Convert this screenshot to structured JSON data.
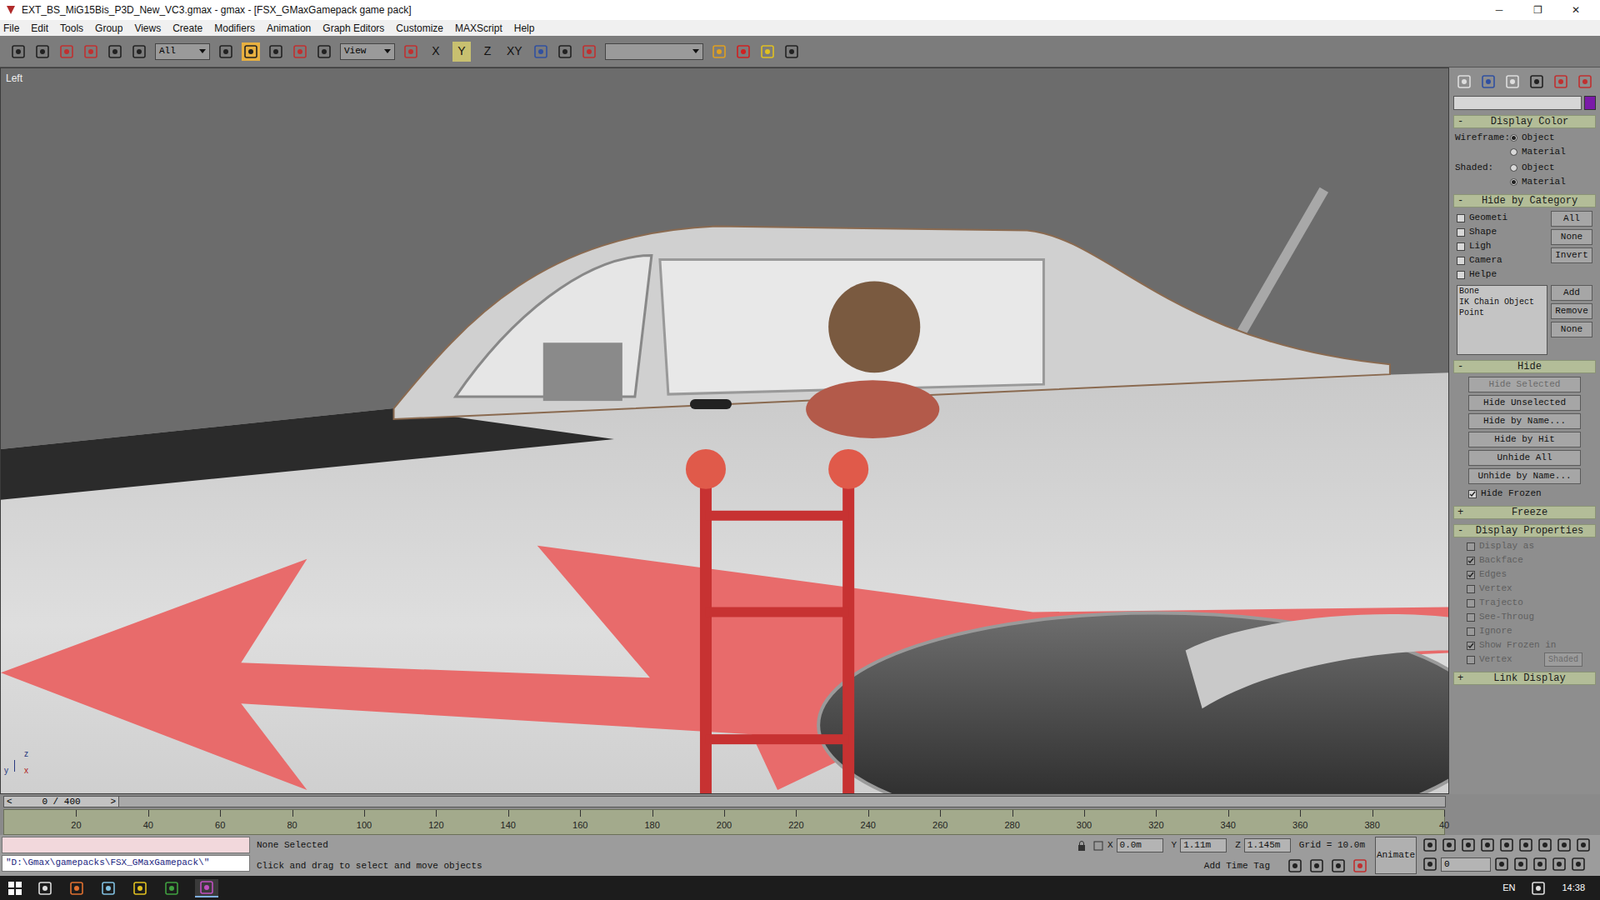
{
  "window": {
    "title": "EXT_BS_MiG15Bis_P3D_New_VC3.gmax - gmax - [FSX_GMaxGamepack game pack]",
    "controls": [
      "─",
      "❐",
      "✕"
    ]
  },
  "menu": [
    "File",
    "Edit",
    "Tools",
    "Group",
    "Views",
    "Create",
    "Modifiers",
    "Animation",
    "Graph Editors",
    "Customize",
    "MAXScript",
    "Help"
  ],
  "toolbar": {
    "selection_filter": "All",
    "reference_coord": "View",
    "named_selection": "",
    "axes": [
      {
        "label": "X",
        "selected": false
      },
      {
        "label": "Y",
        "selected": true
      },
      {
        "label": "Z",
        "selected": false
      },
      {
        "label": "XY",
        "selected": false
      }
    ]
  },
  "viewport": {
    "label": "Left",
    "axis_labels": [
      "z",
      "y",
      "x"
    ]
  },
  "command_panel": {
    "name_field": "",
    "display_color": {
      "title": "Display Color",
      "sign": "-",
      "expanded": true,
      "wireframe_label": "Wireframe:",
      "shaded_label": "Shaded:",
      "wireframe": [
        {
          "label": "Object",
          "selected": true
        },
        {
          "label": "Material",
          "selected": false
        }
      ],
      "shaded": [
        {
          "label": "Object",
          "selected": false
        },
        {
          "label": "Material",
          "selected": true
        }
      ]
    },
    "hide_by_category": {
      "title": "Hide by Category",
      "sign": "-",
      "expanded": true,
      "categories": [
        {
          "label": "Geometi",
          "checked": false
        },
        {
          "label": "Shape",
          "checked": false
        },
        {
          "label": "Ligh",
          "checked": false
        },
        {
          "label": "Camera",
          "checked": false
        },
        {
          "label": "Helpe",
          "checked": false
        }
      ],
      "buttons": [
        "All",
        "None",
        "Invert"
      ],
      "list": [
        "Bone",
        "IK Chain Object",
        "Point"
      ],
      "list_buttons": [
        "Add",
        "Remove",
        "None"
      ]
    },
    "hide": {
      "title": "Hide",
      "sign": "-",
      "expanded": true,
      "buttons": [
        {
          "label": "Hide Selected",
          "disabled": true
        },
        {
          "label": "Hide Unselected",
          "disabled": false
        },
        {
          "label": "Hide by Name...",
          "disabled": false
        },
        {
          "label": "Hide by Hit",
          "disabled": false
        },
        {
          "label": "Unhide All",
          "disabled": false
        },
        {
          "label": "Unhide by Name...",
          "disabled": false
        }
      ],
      "hide_frozen": {
        "label": "Hide Frozen",
        "checked": true
      }
    },
    "freeze": {
      "title": "Freeze",
      "sign": "+",
      "expanded": false
    },
    "display_properties": {
      "title": "Display Properties",
      "sign": "-",
      "expanded": true,
      "options": [
        {
          "label": "Display as",
          "checked": false
        },
        {
          "label": "Backface",
          "checked": true
        },
        {
          "label": "Edges",
          "checked": true
        },
        {
          "label": "Vertex",
          "checked": false
        },
        {
          "label": "Trajecto",
          "checked": false
        },
        {
          "label": "See-Throug",
          "checked": false
        },
        {
          "label": "Ignore",
          "checked": false
        },
        {
          "label": "Show Frozen in",
          "checked": true
        },
        {
          "label": "Vertex",
          "checked": false
        }
      ],
      "disabled": true,
      "shaded_button": "Shaded"
    },
    "link_display": {
      "title": "Link Display",
      "sign": "+",
      "expanded": false
    }
  },
  "time_slider": {
    "label": "0 / 400",
    "prev": "<",
    "next": ">",
    "level": 0
  },
  "track_bar": {
    "ticks": [
      "20",
      "40",
      "60",
      "80",
      "100",
      "120",
      "140",
      "160",
      "180",
      "200",
      "220",
      "240",
      "260",
      "280",
      "300",
      "320",
      "340",
      "360",
      "380",
      "40"
    ]
  },
  "status": {
    "listener": "",
    "path": "\"D:\\Gmax\\gamepacks\\FSX_GMaxGamepack\\\"",
    "selection": "None Selected",
    "prompt": "Click and drag to select and move objects",
    "coords": [
      {
        "axis": "X",
        "value": "0.0m"
      },
      {
        "axis": "Y",
        "value": "1.11m"
      },
      {
        "axis": "Z",
        "value": "1.145m"
      }
    ],
    "grid": "Grid = 10.0m",
    "add_time_tag": "Add Time Tag",
    "animate": "Animate",
    "frame": "0"
  },
  "taskbar": {
    "language": "EN",
    "time": "14:38"
  }
}
